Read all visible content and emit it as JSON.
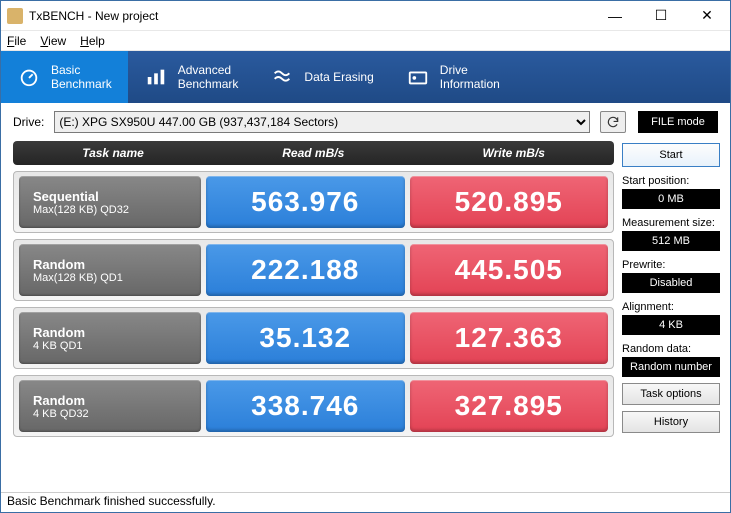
{
  "window": {
    "title": "TxBENCH - New project"
  },
  "menu": {
    "file": "File",
    "view": "View",
    "help": "Help"
  },
  "tabs": {
    "basic": "Basic\nBenchmark",
    "advanced": "Advanced\nBenchmark",
    "erasing": "Data Erasing",
    "driveinfo": "Drive\nInformation"
  },
  "drive": {
    "label": "Drive:",
    "selected": "(E:) XPG SX950U  447.00 GB (937,437,184 Sectors)",
    "filemode": "FILE mode"
  },
  "headers": {
    "task": "Task name",
    "read": "Read mB/s",
    "write": "Write mB/s"
  },
  "rows": [
    {
      "t1": "Sequential",
      "t2": "Max(128 KB) QD32",
      "read": "563.976",
      "write": "520.895"
    },
    {
      "t1": "Random",
      "t2": "Max(128 KB) QD1",
      "read": "222.188",
      "write": "445.505"
    },
    {
      "t1": "Random",
      "t2": "4 KB QD1",
      "read": "35.132",
      "write": "127.363"
    },
    {
      "t1": "Random",
      "t2": "4 KB QD32",
      "read": "338.746",
      "write": "327.895"
    }
  ],
  "side": {
    "start": "Start",
    "startpos_label": "Start position:",
    "startpos": "0 MB",
    "meassize_label": "Measurement size:",
    "meassize": "512 MB",
    "prewrite_label": "Prewrite:",
    "prewrite": "Disabled",
    "alignment_label": "Alignment:",
    "alignment": "4 KB",
    "randomdata_label": "Random data:",
    "randomdata": "Random number",
    "taskoptions": "Task options",
    "history": "History"
  },
  "status": "Basic Benchmark finished successfully."
}
